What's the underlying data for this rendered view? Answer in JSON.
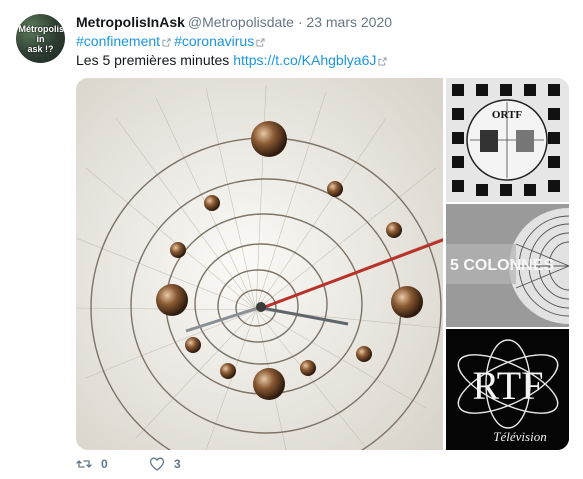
{
  "tweet": {
    "avatar_text": "Métropolis\nin\nask !?",
    "display_name": "MetropolisInAsk",
    "handle": "@Metropolisdate",
    "separator": "·",
    "date": "23 mars 2020",
    "hashtags": [
      "#confinement",
      "#coronavirus"
    ],
    "text": "Les 5 premières minutes",
    "link": "https://t.co/KAhgblya6J",
    "media": {
      "main_image": "spiral-clock-image",
      "side_images": [
        {
          "name": "ortf-test-card-image",
          "text": "ORTF"
        },
        {
          "name": "cinq-colonnes-image",
          "text": "5 COLONNES"
        },
        {
          "name": "rtf-television-image",
          "text": "RTF",
          "caption": "Télévision"
        }
      ]
    },
    "actions": {
      "retweet_count": "0",
      "like_count": "3",
      "retweet_icon": "retweet-icon",
      "like_icon": "heart-icon"
    },
    "colors": {
      "link": "#1b95e0",
      "muted": "#657786",
      "text": "#14171a"
    }
  }
}
